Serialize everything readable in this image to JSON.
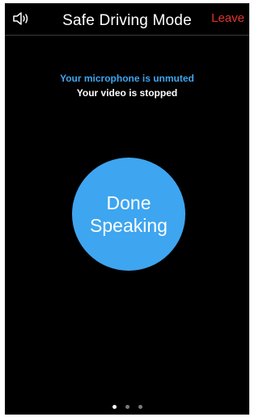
{
  "header": {
    "speaker_icon": "speaker-icon",
    "title": "Safe Driving Mode",
    "leave_label": "Leave"
  },
  "status": {
    "microphone": "Your microphone is unmuted",
    "video": "Your video is stopped"
  },
  "main": {
    "done_line1": "Done",
    "done_line2": "Speaking"
  },
  "pager": {
    "count": 3,
    "active_index": 0
  },
  "colors": {
    "background": "#000000",
    "accent": "#3ea5f0",
    "leave": "#e5322d",
    "text": "#ffffff"
  }
}
